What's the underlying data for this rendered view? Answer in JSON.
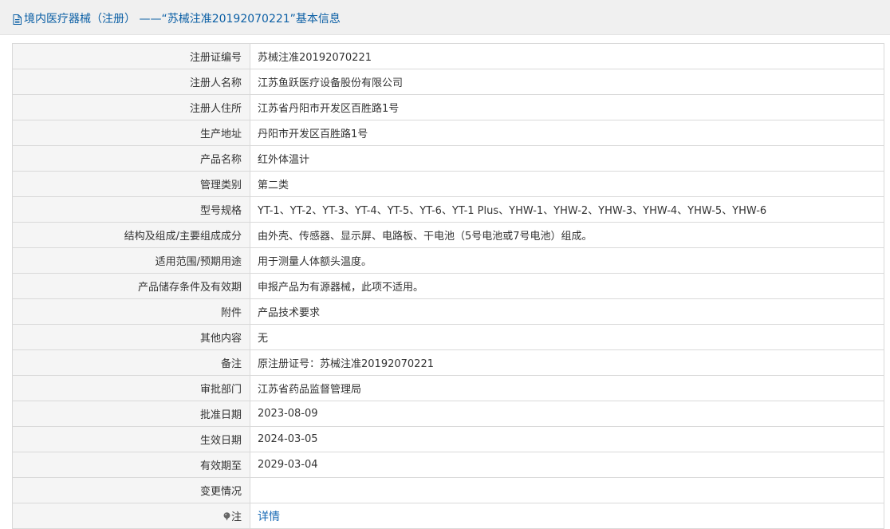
{
  "header": {
    "title": "境内医疗器械（注册） ——“苏械注准20192070221”基本信息"
  },
  "rows": [
    {
      "label": "注册证编号",
      "value": "苏械注准20192070221"
    },
    {
      "label": "注册人名称",
      "value": "江苏鱼跃医疗设备股份有限公司"
    },
    {
      "label": "注册人住所",
      "value": "江苏省丹阳市开发区百胜路1号"
    },
    {
      "label": "生产地址",
      "value": "丹阳市开发区百胜路1号"
    },
    {
      "label": "产品名称",
      "value": "红外体温计"
    },
    {
      "label": "管理类别",
      "value": "第二类"
    },
    {
      "label": "型号规格",
      "value": "YT-1、YT-2、YT-3、YT-4、YT-5、YT-6、YT-1 Plus、YHW-1、YHW-2、YHW-3、YHW-4、YHW-5、YHW-6"
    },
    {
      "label": "结构及组成/主要组成成分",
      "value": "由外壳、传感器、显示屏、电路板、干电池（5号电池或7号电池）组成。"
    },
    {
      "label": "适用范围/预期用途",
      "value": "用于测量人体额头温度。"
    },
    {
      "label": "产品储存条件及有效期",
      "value": "申报产品为有源器械，此项不适用。"
    },
    {
      "label": "附件",
      "value": "产品技术要求"
    },
    {
      "label": "其他内容",
      "value": "无"
    },
    {
      "label": "备注",
      "value": "原注册证号：苏械注准20192070221"
    },
    {
      "label": "审批部门",
      "value": "江苏省药品监督管理局"
    },
    {
      "label": "批准日期",
      "value": "2023-08-09"
    },
    {
      "label": "生效日期",
      "value": "2024-03-05"
    },
    {
      "label": "有效期至",
      "value": "2029-03-04"
    },
    {
      "label": "变更情况",
      "value": ""
    }
  ],
  "note_row": {
    "label": "注",
    "icon": "note-icon",
    "link_text": "详情"
  },
  "colors": {
    "header_text": "#0b5fa5",
    "link": "#1a6bb5",
    "label_bg": "#f5f5f5",
    "border": "#d9d9d9"
  }
}
